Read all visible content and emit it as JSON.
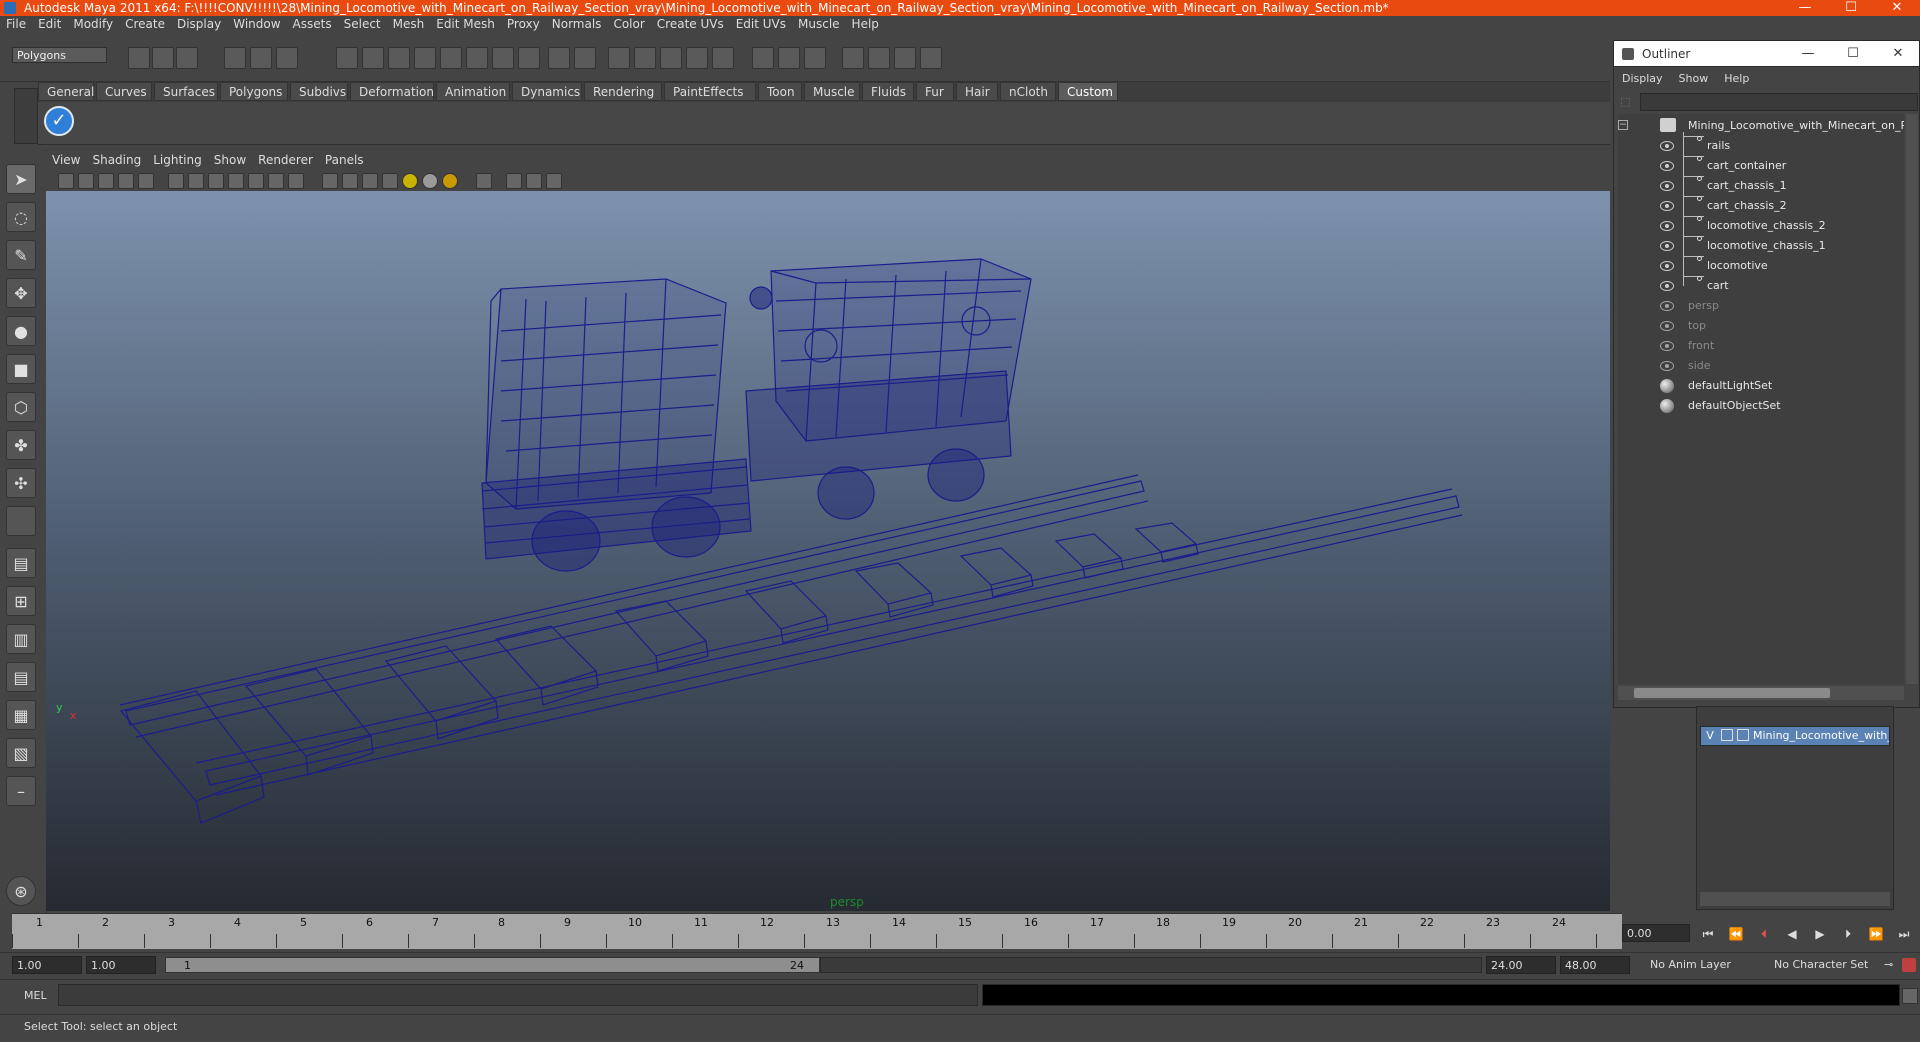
{
  "window": {
    "title": "Autodesk Maya 2011 x64: F:\\!!!!CONV!!!!!\\28\\Mining_Locomotive_with_Minecart_on_Railway_Section_vray\\Mining_Locomotive_with_Minecart_on_Railway_Section_vray\\Mining_Locomotive_with_Minecart_on_Railway_Section.mb*",
    "minimize": "—",
    "maximize": "☐",
    "close": "✕",
    "titlebar_color": "#e84a10"
  },
  "menubar": [
    "File",
    "Edit",
    "Modify",
    "Create",
    "Display",
    "Window",
    "Assets",
    "Select",
    "Mesh",
    "Edit Mesh",
    "Proxy",
    "Normals",
    "Color",
    "Create UVs",
    "Edit UVs",
    "Muscle",
    "Help"
  ],
  "statusline": {
    "mode": "Polygons"
  },
  "shelf": {
    "tabs": [
      "General",
      "Curves",
      "Surfaces",
      "Polygons",
      "Subdivs",
      "Deformation",
      "Animation",
      "Dynamics",
      "Rendering",
      "PaintEffects",
      "Toon",
      "Muscle",
      "Fluids",
      "Fur",
      "Hair",
      "nCloth",
      "Custom"
    ],
    "active_tab": "Custom",
    "checkmark": "✓"
  },
  "viewport": {
    "menu": [
      "View",
      "Shading",
      "Lighting",
      "Show",
      "Renderer",
      "Panels"
    ],
    "camera_label": "persp",
    "axis_y": "y",
    "axis_x": "x",
    "wireframe_color": "#161a8a"
  },
  "timeline": {
    "ticks": [
      "1",
      "2",
      "3",
      "4",
      "5",
      "6",
      "7",
      "8",
      "9",
      "10",
      "11",
      "12",
      "13",
      "14",
      "15",
      "16",
      "17",
      "18",
      "19",
      "20",
      "21",
      "22",
      "23",
      "24"
    ],
    "current_time": "0.00"
  },
  "range": {
    "start": "1.00",
    "playback_start": "1.00",
    "slider_start": "1",
    "slider_end": "24",
    "playback_end": "24.00",
    "end": "48.00",
    "anim_layer": "No Anim Layer",
    "character_set": "No Character Set"
  },
  "command": {
    "mel_label": "MEL"
  },
  "helpline": {
    "text": "Select Tool: select an object"
  },
  "outliner": {
    "title": "Outliner",
    "menu": [
      "Display",
      "Show",
      "Help"
    ],
    "root": "Mining_Locomotive_with_Minecart_on_Railway_Section",
    "children": [
      "rails",
      "cart_container",
      "cart_chassis_1",
      "cart_chassis_2",
      "locomotive_chassis_2",
      "locomotive_chassis_1",
      "locomotive",
      "cart"
    ],
    "cameras": [
      "persp",
      "top",
      "front",
      "side"
    ],
    "sets": [
      "defaultLightSet",
      "defaultObjectSet"
    ]
  },
  "layers": {
    "layer_name": "Mining_Locomotive_with_Minecart_on_Railway_Section_layer",
    "visible_flag": "V"
  }
}
